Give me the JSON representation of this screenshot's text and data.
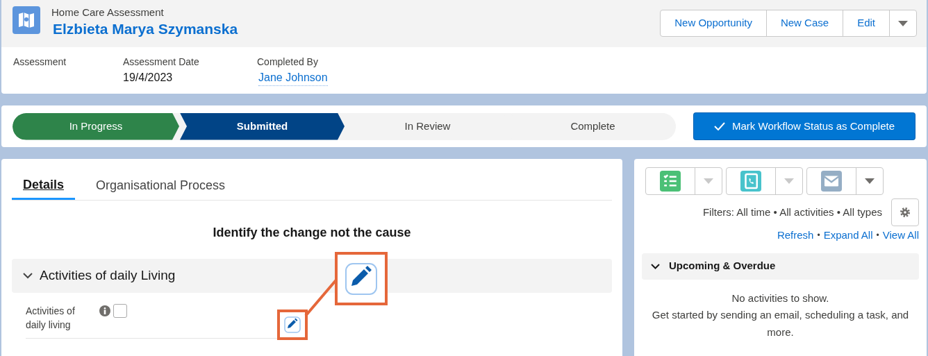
{
  "record_header": {
    "object_type": "Home Care Assessment",
    "title": "Elzbieta Marya Szymanska",
    "actions": [
      "New Opportunity",
      "New Case",
      "Edit"
    ],
    "fields": [
      {
        "label": "Assessment"
      },
      {
        "label": "Assessment Date",
        "value": "19/4/2023"
      },
      {
        "label": "Completed By",
        "value": "Jane Johnson",
        "kind": "link"
      }
    ]
  },
  "path": {
    "stages": [
      {
        "label": "In Progress",
        "completed": true,
        "selected": false
      },
      {
        "label": "Submitted",
        "completed": false,
        "selected": true
      },
      {
        "label": "In Review",
        "completed": false,
        "selected": false
      },
      {
        "label": "Complete",
        "completed": false,
        "selected": false
      }
    ],
    "button": "Mark Workflow Status as Complete"
  },
  "tabs": [
    {
      "label": "Details",
      "selected": true
    },
    {
      "label": "Organisational Process",
      "selected": false
    }
  ],
  "details": {
    "heading": "Identify the change not the cause",
    "section": {
      "title": "Activities of daily Living",
      "expanded": true,
      "fields": [
        {
          "label": "Activities of daily living",
          "checked": false
        }
      ]
    }
  },
  "activity": {
    "buttons": [
      {
        "kind": "task",
        "color": "#4bc076",
        "dropdown_disabled": true
      },
      {
        "kind": "call",
        "color": "#48c3cc",
        "dropdown_disabled": true
      },
      {
        "kind": "email",
        "color": "#95aec5",
        "dropdown_disabled": false
      }
    ],
    "filters": "Filters: All time • All activities • All types",
    "links": [
      "Refresh",
      "Expand All",
      "View All"
    ],
    "separator": "•",
    "section": {
      "title": "Upcoming & Overdue",
      "expanded": true
    },
    "empty_title": "No activities to show.",
    "empty_text": "Get started by sending an email, scheduling a task, and more."
  }
}
